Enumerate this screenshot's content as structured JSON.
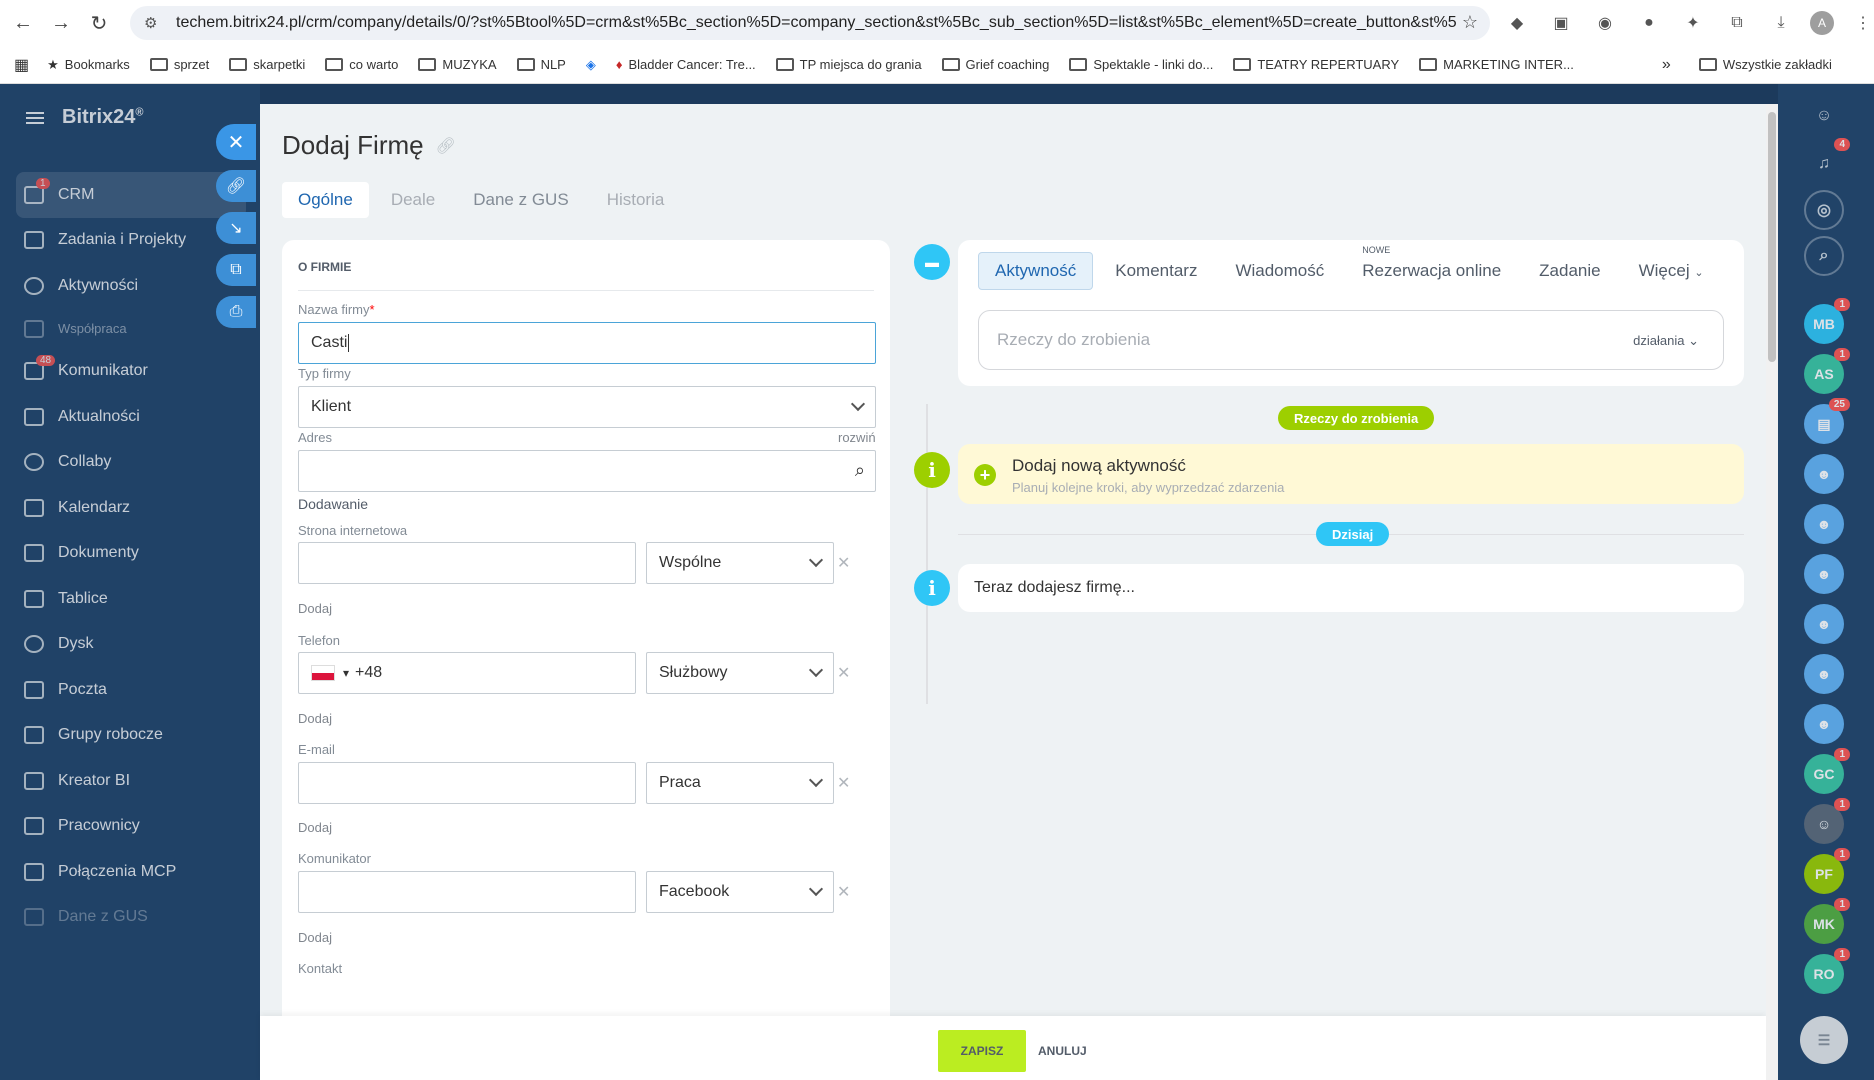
{
  "browser": {
    "url": "techem.bitrix24.pl/crm/company/details/0/?st%5Btool%5D=crm&st%5Bc_section%5D=company_section&st%5Bc_sub_section%5D=list&st%5Bc_element%5D=create_button&st%5Bp1%5D...",
    "bookmarks": [
      "Bookmarks",
      "sprzet",
      "skarpetki",
      "co warto",
      "MUZYKA",
      "NLP",
      "Bladder Cancer: Tre...",
      "TP miejsca do grania",
      "Grief coaching",
      "Spektakle - linki do...",
      "TEATRY REPERTUARY",
      "MARKETING INTER..."
    ],
    "all_bookmarks": "Wszystkie zakładki",
    "profile_initial": "A"
  },
  "sidebar": {
    "logo": "Bitrix24",
    "logo_mark": "®",
    "items": [
      {
        "label": "CRM",
        "badge": "1"
      },
      {
        "label": "Zadania i Projekty",
        "badge": ""
      },
      {
        "label": "Aktywności",
        "badge": ""
      },
      {
        "label": "Współpraca",
        "badge": ""
      },
      {
        "label": "Komunikator",
        "badge": "48"
      },
      {
        "label": "Aktualności",
        "badge": ""
      },
      {
        "label": "Collaby",
        "badge": ""
      },
      {
        "label": "Kalendarz",
        "badge": ""
      },
      {
        "label": "Dokumenty",
        "badge": ""
      },
      {
        "label": "Tablice",
        "badge": ""
      },
      {
        "label": "Dysk",
        "badge": ""
      },
      {
        "label": "Poczta",
        "badge": ""
      },
      {
        "label": "Grupy robocze",
        "badge": ""
      },
      {
        "label": "Kreator BI",
        "badge": ""
      },
      {
        "label": "Pracownicy",
        "badge": ""
      },
      {
        "label": "Połączenia MCP",
        "badge": ""
      },
      {
        "label": "Dane z GUS",
        "badge": ""
      }
    ]
  },
  "panel": {
    "title": "Dodaj Firmę",
    "tabs": [
      "Ogólne",
      "Deale",
      "Dane z GUS",
      "Historia"
    ]
  },
  "form": {
    "section_title": "O FIRMIE",
    "company_name_label": "Nazwa firmy",
    "required_mark": "*",
    "company_name_value": "Casti",
    "company_type_label": "Typ firmy",
    "company_type_value": "Klient",
    "address_label": "Adres",
    "address_expand": "rozwiń",
    "add_label": "Dodawanie",
    "website_label": "Strona internetowa",
    "website_type": "Wspólne",
    "add_link": "Dodaj",
    "phone_label": "Telefon",
    "phone_prefix": "+48",
    "phone_type": "Służbowy",
    "email_label": "E-mail",
    "email_type": "Praca",
    "messenger_label": "Komunikator",
    "messenger_type": "Facebook",
    "contact_label": "Kontakt"
  },
  "activity": {
    "tabs": [
      "Aktywność",
      "Komentarz",
      "Wiadomość",
      "Rezerwacja online",
      "Zadanie",
      "Więcej"
    ],
    "new_tag": "NOWE",
    "todo_placeholder": "Rzeczy do zrobienia",
    "todo_actions": "działania",
    "todo_pill": "Rzeczy do zrobienia",
    "new_activity_title": "Dodaj nową aktywność",
    "new_activity_sub": "Planuj kolejne kroki, aby wyprzedzać zdarzenia",
    "today_pill": "Dzisiaj",
    "now_adding": "Teraz dodajesz firmę..."
  },
  "footer": {
    "save": "ZAPISZ",
    "cancel": "ANULUJ"
  },
  "rightbar": {
    "avatars": [
      {
        "initials": "MB",
        "badge": "1"
      },
      {
        "initials": "AS",
        "badge": "1"
      },
      {
        "initials": "",
        "badge": "25"
      },
      {
        "initials": "GC",
        "badge": "1"
      },
      {
        "initials": "PF",
        "badge": "1"
      },
      {
        "initials": "MK",
        "badge": "1"
      },
      {
        "initials": "RO",
        "badge": "1"
      }
    ],
    "notifications_badge": "4"
  },
  "colors": {
    "accent_blue": "#2067b0",
    "save_green": "#bbed21",
    "timeline_green": "#9dcf00",
    "timeline_blue": "#2fc6f6"
  }
}
